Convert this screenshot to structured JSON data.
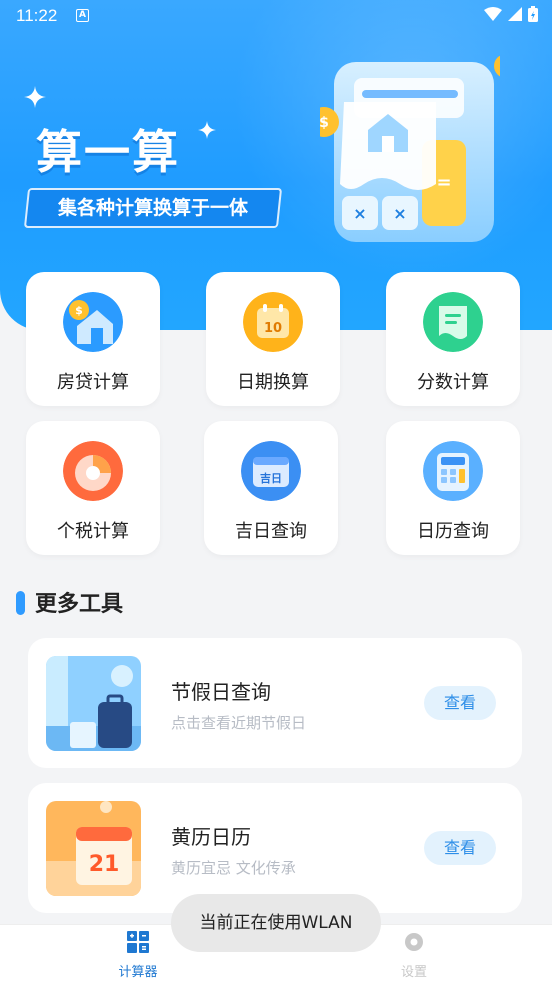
{
  "status_bar": {
    "time": "11:22"
  },
  "banner": {
    "title": "算一算",
    "subtitle": "集各种计算换算于一体"
  },
  "grid": [
    {
      "label": "房贷计算",
      "icon": "house-loan-icon"
    },
    {
      "label": "日期换算",
      "icon": "calendar-date-icon"
    },
    {
      "label": "分数计算",
      "icon": "receipt-icon"
    },
    {
      "label": "个税计算",
      "icon": "pie-chart-icon"
    },
    {
      "label": "吉日查询",
      "icon": "lucky-day-calendar-icon"
    },
    {
      "label": "日历查询",
      "icon": "calculator-icon"
    }
  ],
  "grid_day_number": "10",
  "grid_lucky_text": "吉日",
  "section": {
    "title": "更多工具"
  },
  "tools": [
    {
      "name": "节假日查询",
      "desc": "点击查看近期节假日",
      "button": "查看"
    },
    {
      "name": "黄历日历",
      "desc": "黄历宜忌 文化传承",
      "button": "查看",
      "day": "21"
    }
  ],
  "tabs": [
    {
      "label": "计算器",
      "active": true
    },
    {
      "label": "设置",
      "active": false
    }
  ],
  "toast": {
    "text": "当前正在使用WLAN"
  },
  "colors": {
    "primary": "#1f9cff",
    "active_tab": "#1f78d1",
    "inactive_tab": "#c8c8c8"
  }
}
